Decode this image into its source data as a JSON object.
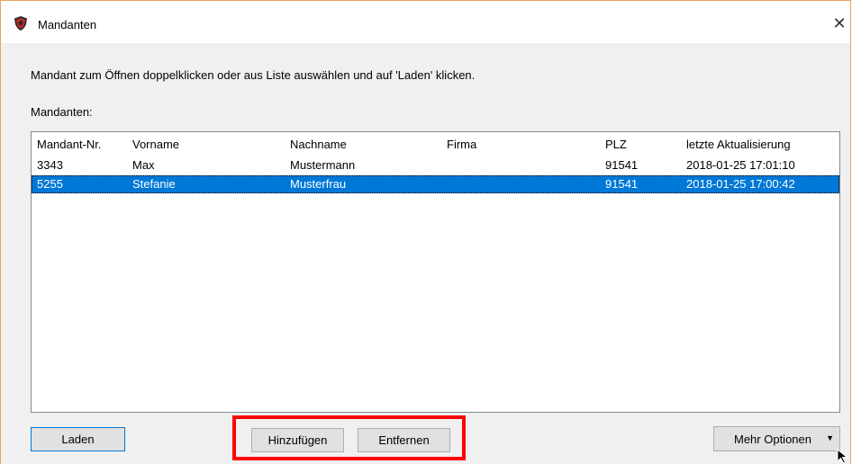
{
  "window": {
    "title": "Mandanten",
    "close_glyph": "✕",
    "accent_color": "#e8a25a"
  },
  "instructions": "Mandant zum Öffnen doppelklicken oder aus Liste auswählen und auf 'Laden' klicken.",
  "list_label": "Mandanten:",
  "table": {
    "columns": [
      "Mandant-Nr.",
      "Vorname",
      "Nachname",
      "Firma",
      "PLZ",
      "letzte Aktualisierung"
    ],
    "rows": [
      [
        "3343",
        "Max",
        "Mustermann",
        "",
        "91541",
        "2018-01-25 17:01:10"
      ],
      [
        "5255",
        "Stefanie",
        "Musterfrau",
        "",
        "91541",
        "2018-01-25 17:00:42"
      ]
    ],
    "selected_row": 1,
    "selection_color": "#0078d7"
  },
  "buttons": {
    "load": "Laden",
    "add": "Hinzufügen",
    "remove": "Entfernen",
    "more_options": "Mehr Optionen",
    "more_arrow": "▼"
  },
  "annotation": {
    "highlight_color": "#ff0000"
  },
  "icons": {
    "app": "shield-app-icon",
    "cursor": "mouse-pointer-icon"
  }
}
